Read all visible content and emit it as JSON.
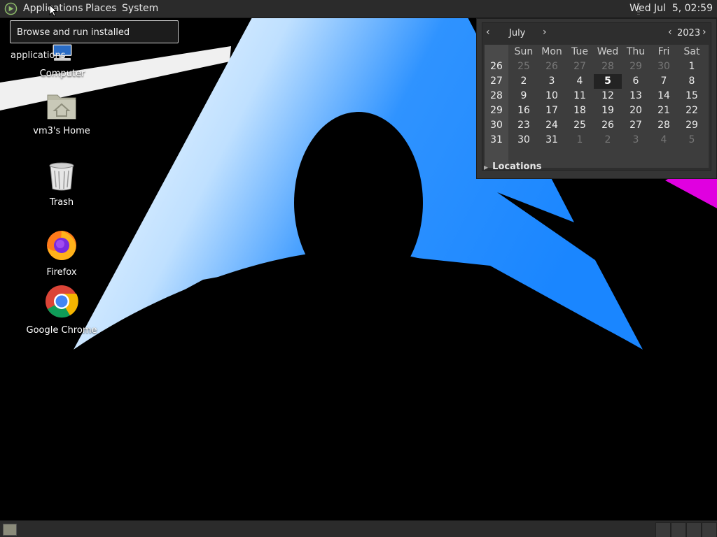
{
  "top_panel": {
    "menus": [
      "Applications",
      "Places",
      "System"
    ],
    "clock": "Wed Jul  5, 02:59"
  },
  "tooltip": "Browse and run installed applications",
  "desktop_icons": [
    {
      "label": "Computer",
      "icon": "computer-icon"
    },
    {
      "label": "vm3's Home",
      "icon": "home-folder-icon"
    },
    {
      "label": "Trash",
      "icon": "trash-icon"
    },
    {
      "label": "Firefox",
      "icon": "firefox-icon"
    },
    {
      "label": "Google Chrome",
      "icon": "chrome-icon"
    }
  ],
  "calendar": {
    "month": "July",
    "year": "2023",
    "prev_symbol": "‹",
    "next_symbol": "›",
    "weekday_headers": [
      "Sun",
      "Mon",
      "Tue",
      "Wed",
      "Thu",
      "Fri",
      "Sat"
    ],
    "week_numbers": [
      "26",
      "27",
      "28",
      "29",
      "30",
      "31"
    ],
    "weeks": [
      [
        "25",
        "26",
        "27",
        "28",
        "29",
        "30",
        "1"
      ],
      [
        "2",
        "3",
        "4",
        "5",
        "6",
        "7",
        "8"
      ],
      [
        "9",
        "10",
        "11",
        "12",
        "13",
        "14",
        "15"
      ],
      [
        "16",
        "17",
        "18",
        "19",
        "20",
        "21",
        "22"
      ],
      [
        "23",
        "24",
        "25",
        "26",
        "27",
        "28",
        "29"
      ],
      [
        "30",
        "31",
        "1",
        "2",
        "3",
        "4",
        "5"
      ]
    ],
    "today": "5",
    "locations_label": "Locations"
  },
  "colors": {
    "panel": "#2b2b2b",
    "wallpaper_blue": "#1e90ff",
    "wallpaper_magenta": "#e000e0"
  }
}
